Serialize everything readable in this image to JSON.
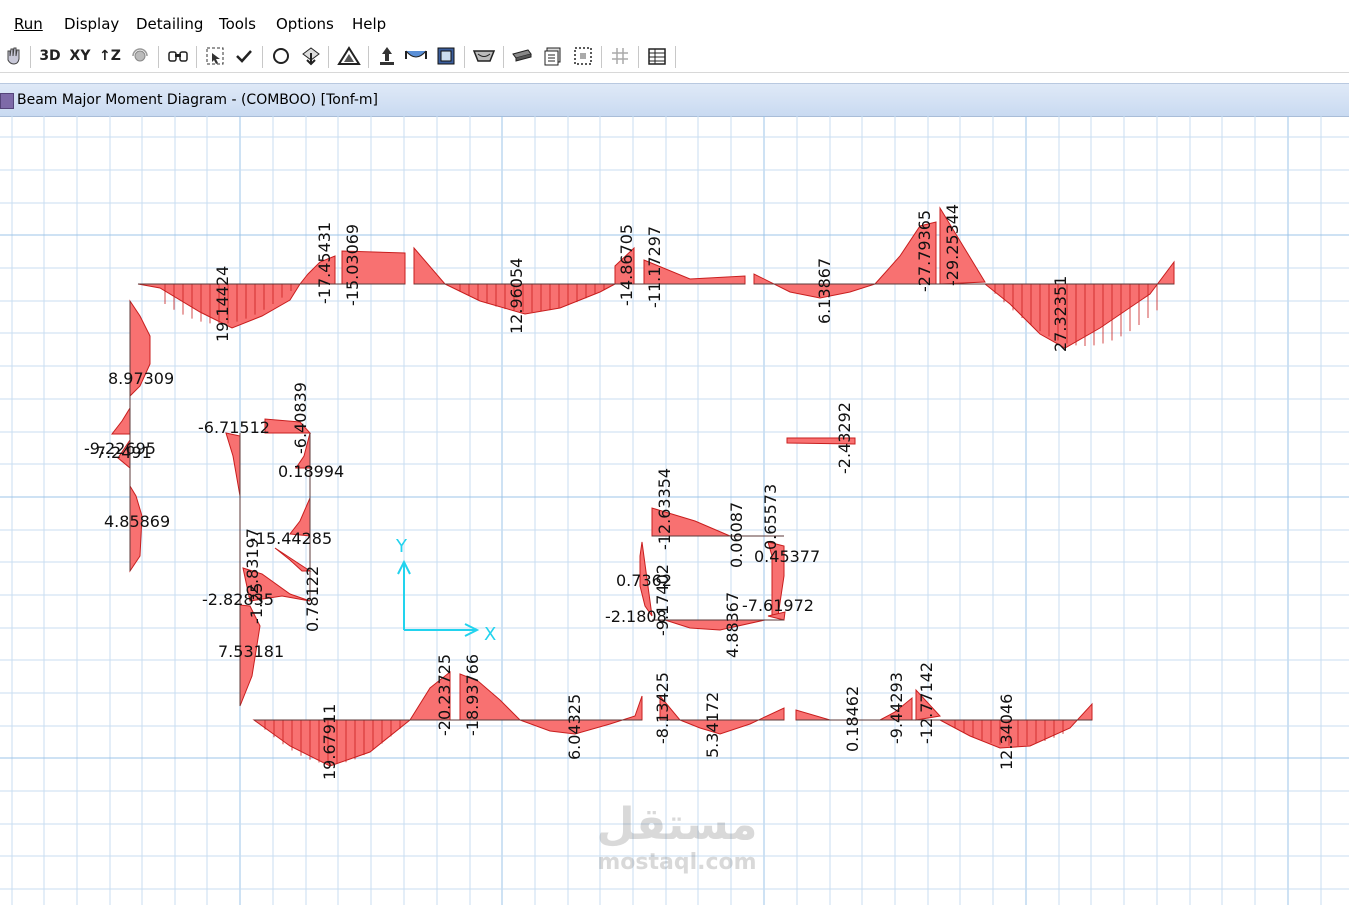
{
  "menu": [
    "Run",
    "Display",
    "Detailing",
    "Tools",
    "Options",
    "Help"
  ],
  "menu_underline_index": [
    0,
    0,
    2,
    3,
    0,
    0
  ],
  "toolbar": {
    "btn_3d": "3D",
    "btn_xy": "XY",
    "btn_z": "↑Z",
    "icons": [
      "hand-icon",
      "view-3d-button",
      "plan-xy-button",
      "elevation-z-button",
      "rotate-view-icon",
      "binoculars-icon",
      "select-icon",
      "check-icon",
      "circle-icon",
      "load-arrow-icon",
      "triangle-icon",
      "support-icon",
      "deformed-shape-icon",
      "animate-icon",
      "moment-diagram-icon",
      "beam-icon",
      "layers-icon",
      "select-area-icon",
      "grid-icon",
      "table-icon"
    ]
  },
  "window": {
    "title": "Beam Major Moment Diagram - (COMBOO)  [Tonf-m]"
  },
  "axes": {
    "x": "X",
    "y": "Y"
  },
  "colors": {
    "diagram_fill": "#f87171",
    "diagram_stroke": "#c81e1e",
    "grid_minor": "#c8def2",
    "grid_major": "#9cc4e8",
    "axis": "#22d3ee"
  },
  "labels": {
    "top_a1": "19.14424",
    "top_a2": "-17.45431",
    "top_a3": "-15.03069",
    "top_b1": "12.96054",
    "top_b2": "-14.86705",
    "top_b3": "-11.17297",
    "top_c1": "6.13867",
    "top_c2": "-27.79365",
    "top_c3": "-29.25344",
    "top_c4": "27.32351",
    "left_1": "8.97309",
    "left_2": "-9.22695",
    "left_3": "-7.2491",
    "left_4": "4.85869",
    "mid_1": "-6.71512",
    "mid_2": "-6.40839",
    "mid_3": "0.18994",
    "mid_4": "-15.44285",
    "mid_5": "-2.83197",
    "mid_6": "-2.82835",
    "mid_7": "-1.25",
    "mid_8": "0.78122",
    "mid_9": "7.53181",
    "right_1": "-2.43292",
    "ctr_1": "-12.63354",
    "ctr_2": "0.06087",
    "ctr_3": "0.65573",
    "ctr_4": "0.45377",
    "ctr_5": "0.7362",
    "ctr_6": "-2.1808",
    "ctr_7": "-9.17402",
    "ctr_8": "4.88367",
    "ctr_9": "-7.61972",
    "bot_a1": "19.67911",
    "bot_a2": "-20.23725",
    "bot_a3": "-18.93766",
    "bot_b1": "6.04325",
    "bot_b2": "-8.13425",
    "bot_b3": "5.34172",
    "bot_c1": "0.18462",
    "bot_c2": "-9.44293",
    "bot_c3": "-12.77142",
    "bot_c4": "12.34046"
  },
  "watermark": {
    "arabic": "مستقل",
    "latin": "mostaql.com"
  }
}
